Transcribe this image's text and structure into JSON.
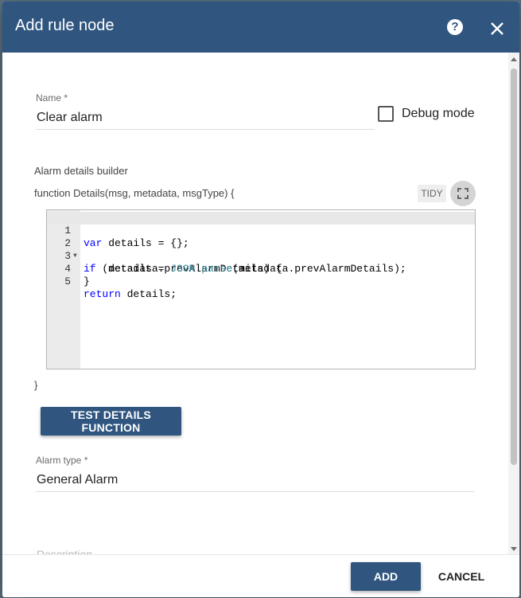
{
  "dialog": {
    "title": "Add rule node",
    "help_icon": "help-circle-icon",
    "close_icon": "close-icon"
  },
  "form": {
    "name_label": "Name",
    "required_mark": "*",
    "name_value": "Clear alarm",
    "debug_label": "Debug mode",
    "debug_checked": false,
    "builder_label": "Alarm details builder",
    "function_signature": "function Details(msg, metadata, msgType) {",
    "tidy_label": "TIDY",
    "fullscreen_icon": "fullscreen-icon",
    "code_lines": [
      {
        "num": "1",
        "text": "var details = {};"
      },
      {
        "num": "2",
        "text": "if (metadata.prevAlarmDetails) {"
      },
      {
        "num": "3",
        "text": "    details = JSON.parse(metadata.prevAlarmDetails);"
      },
      {
        "num": "4",
        "text": "}"
      },
      {
        "num": "5",
        "text": "return details;"
      }
    ],
    "closing_brace": "}",
    "test_button": "TEST DETAILS FUNCTION",
    "alarm_type_label": "Alarm type",
    "alarm_type_value": "General Alarm",
    "description_label": "Description"
  },
  "footer": {
    "add_label": "ADD",
    "cancel_label": "CANCEL"
  },
  "colors": {
    "primary": "#305680",
    "backdrop": "#5a6f7e"
  }
}
